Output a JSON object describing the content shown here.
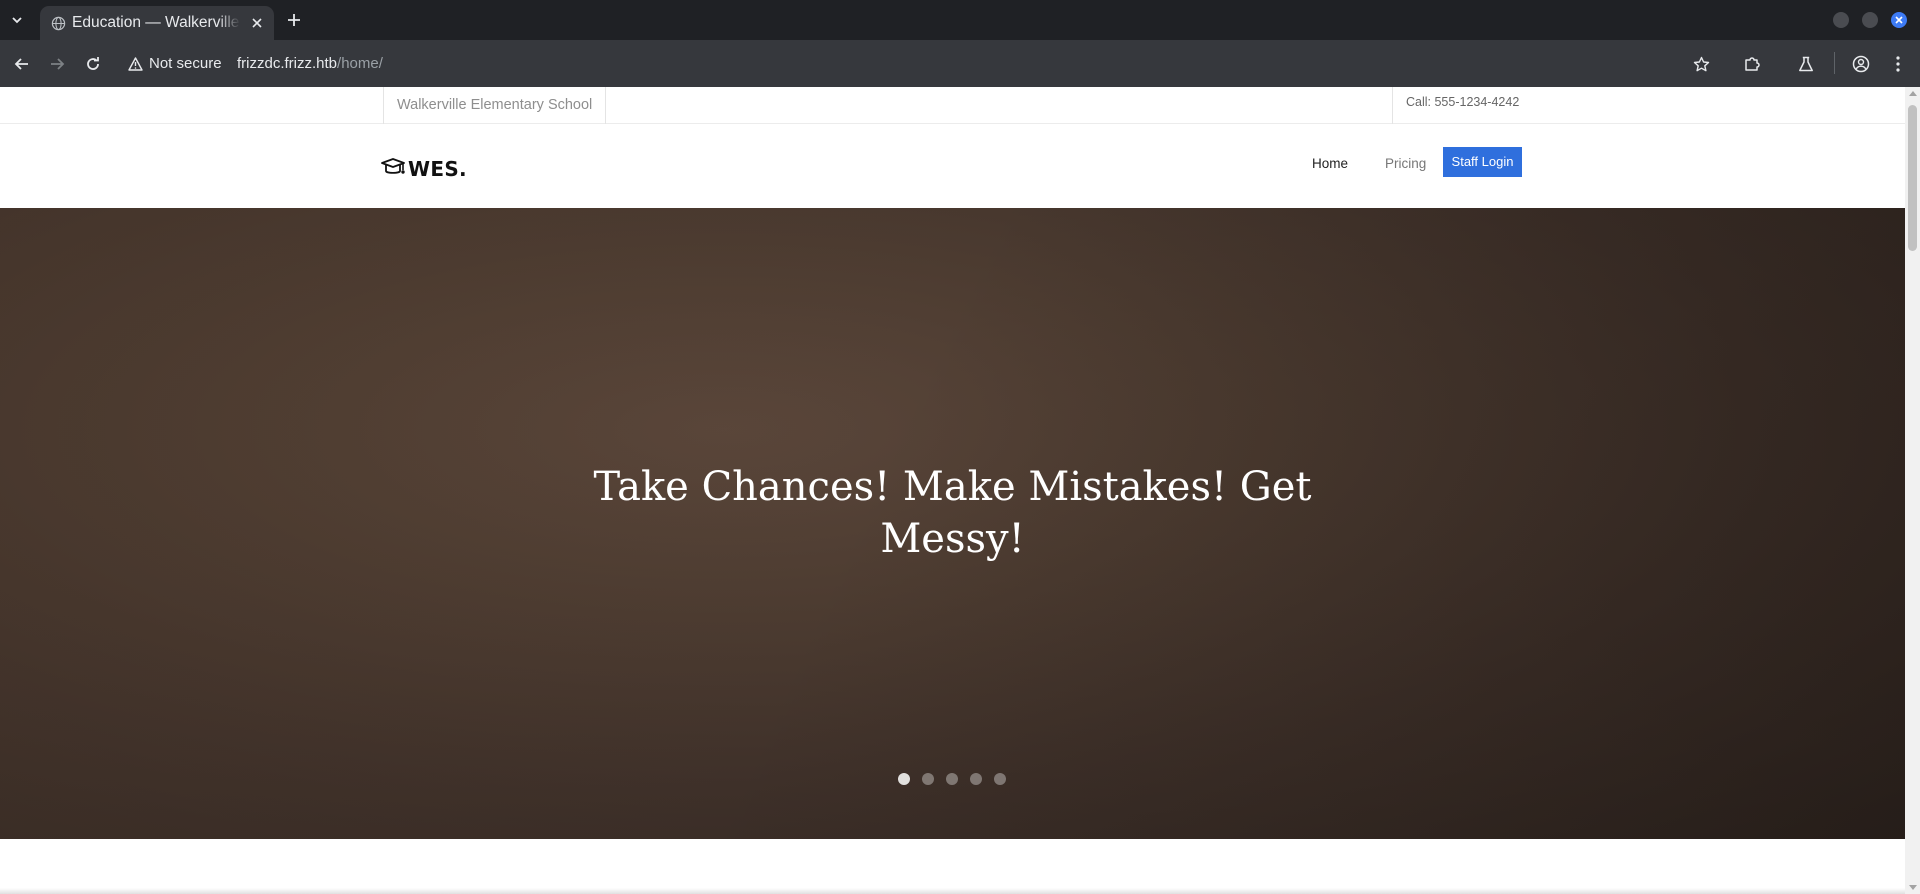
{
  "browser": {
    "tab_title": "Education — Walkerville Elementary School",
    "security_label": "Not secure",
    "url_host": "frizzdc.frizz.htb",
    "url_path": "/home/"
  },
  "site": {
    "school_name": "Walkerville Elementary School",
    "call": "Call: 555-1234-4242",
    "logo_text": "WES.",
    "nav": {
      "home": "Home",
      "pricing": "Pricing",
      "staff_login": "Staff Login"
    },
    "hero": {
      "title": "Take Chances! Make Mistakes! Get Messy!",
      "slide_count": 5,
      "active_slide": 1
    }
  },
  "colors": {
    "accent": "#2f6fdd",
    "browser_dark": "#1f2125",
    "browser_toolbar": "#36383d",
    "hero_brown": "#4d3c31"
  },
  "icons": [
    "tab-list-icon",
    "globe-icon",
    "close-icon",
    "plus-icon",
    "back-icon",
    "forward-icon",
    "reload-icon",
    "warning-icon",
    "star-icon",
    "extensions-icon",
    "labs-icon",
    "profile-icon",
    "menu-icon",
    "graduation-cap-icon"
  ]
}
